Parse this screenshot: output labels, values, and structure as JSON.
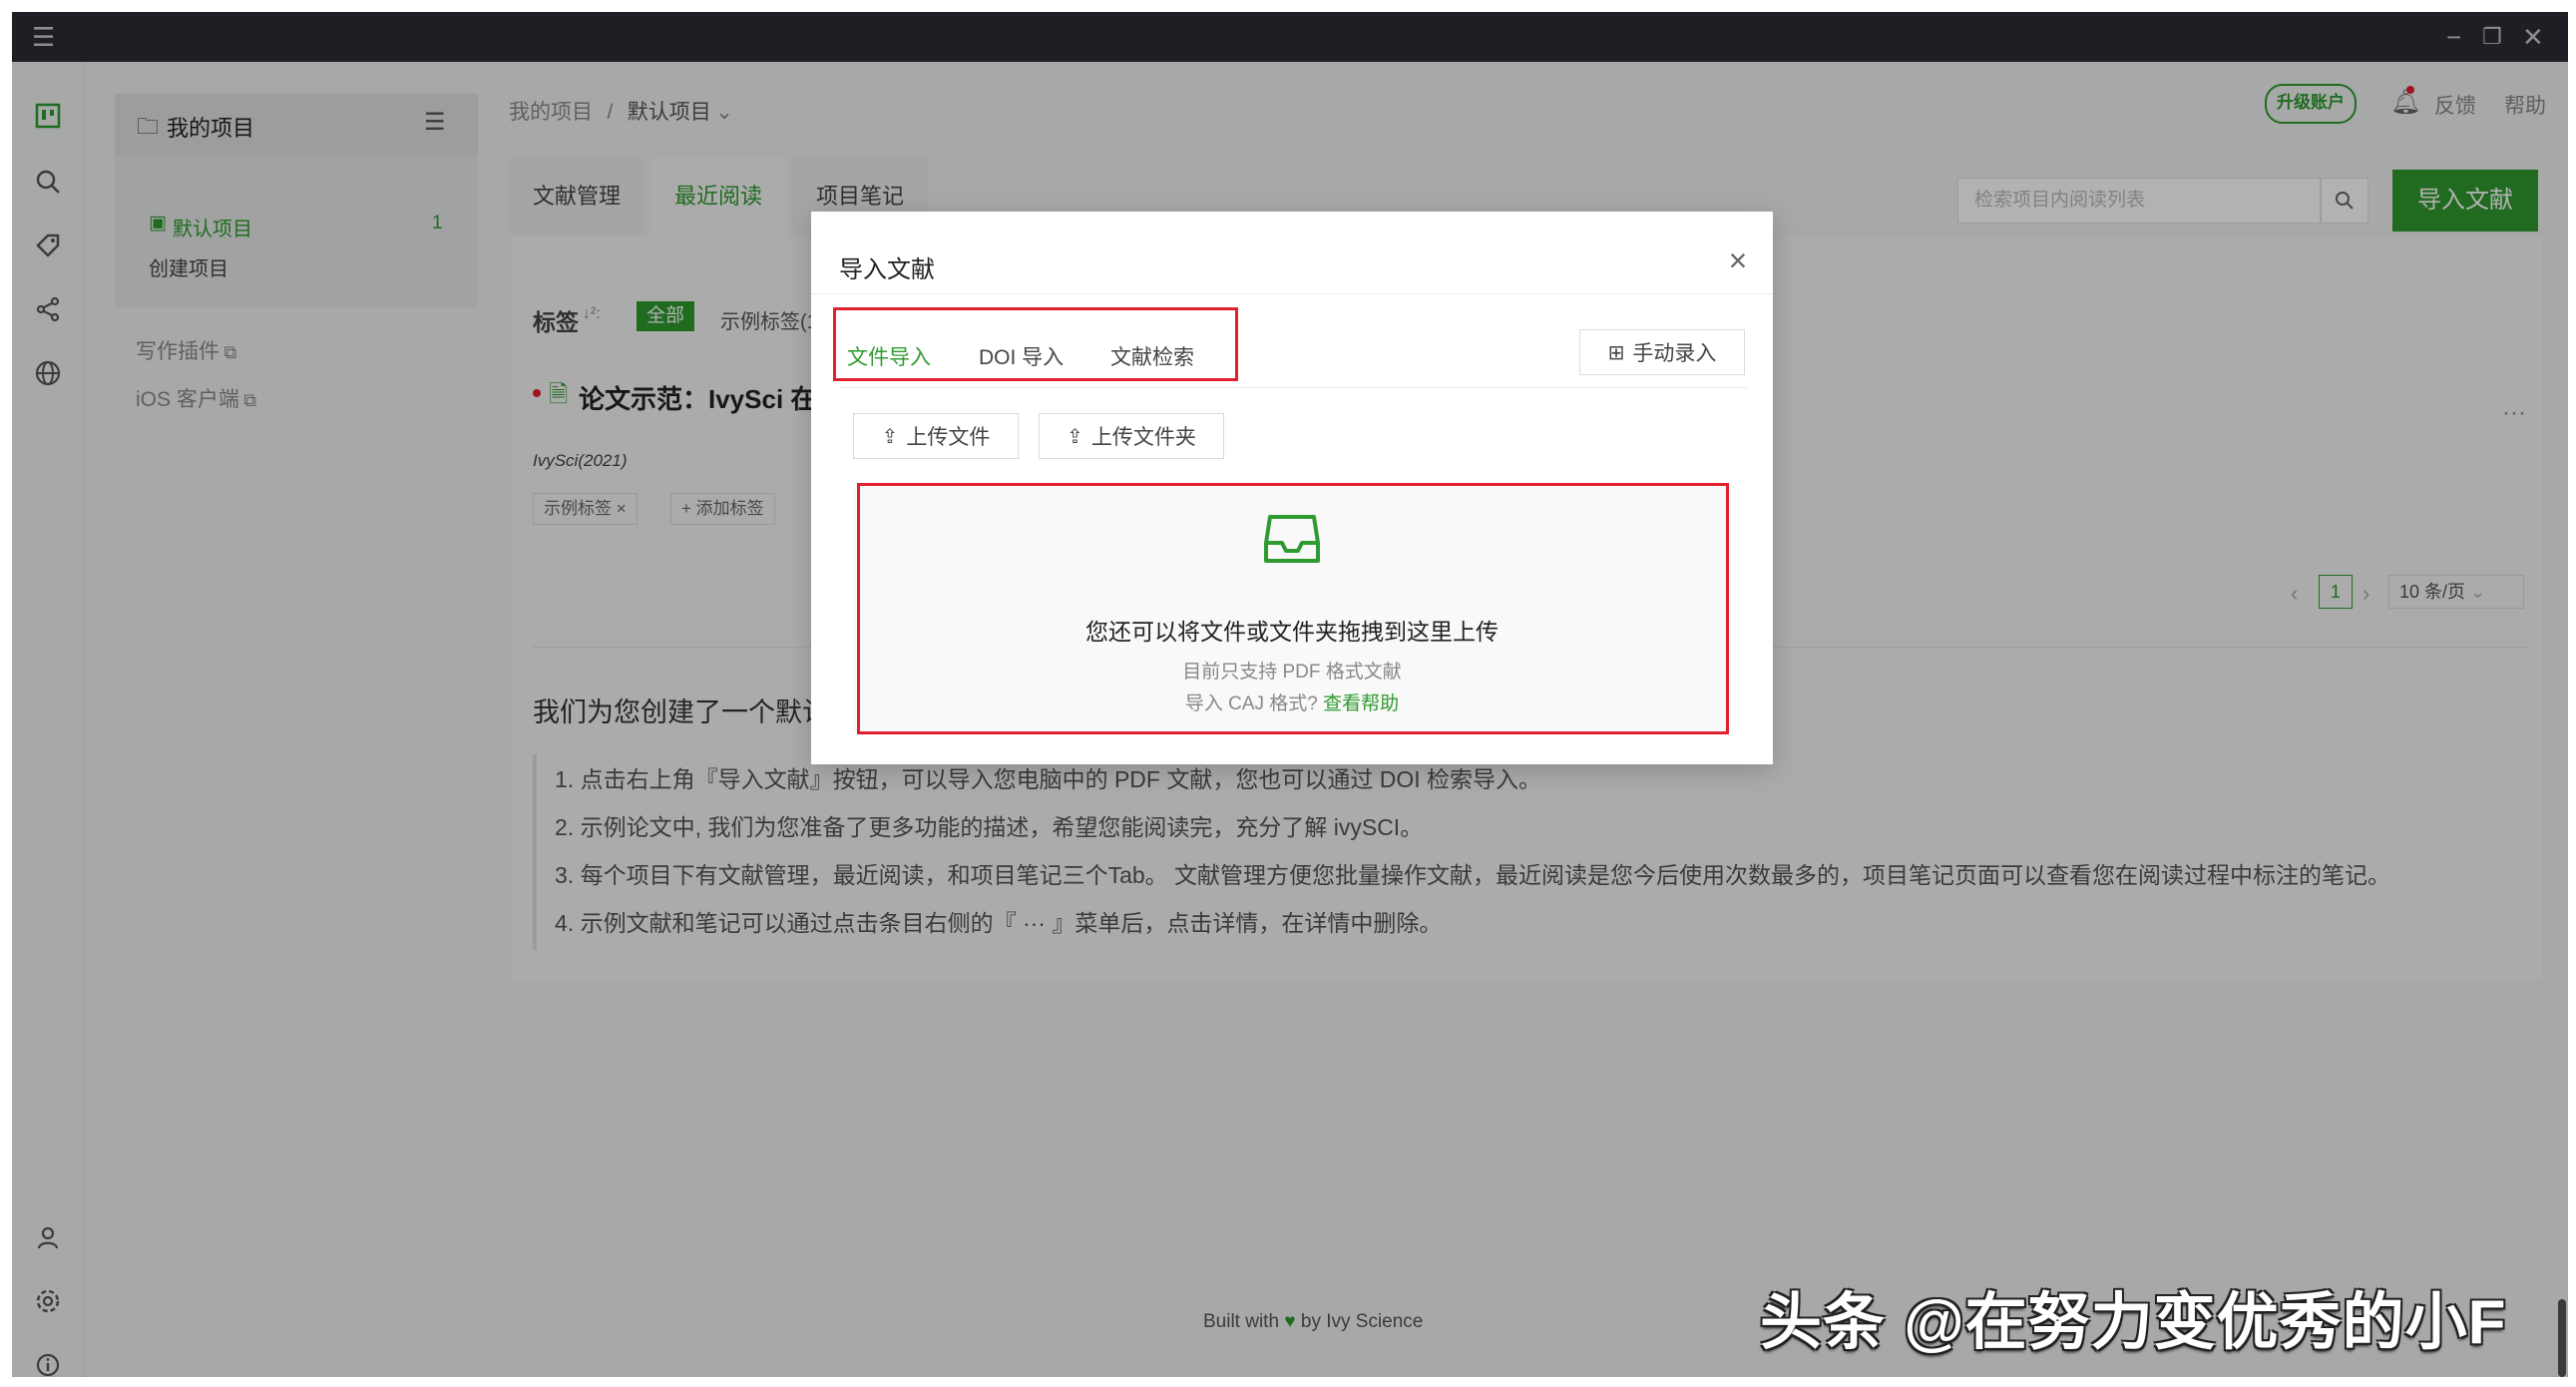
{
  "sidebar": {
    "section_title": "我的项目",
    "projects": [
      {
        "label": "默认项目",
        "count": "1"
      }
    ],
    "create_label": "创建项目",
    "links": [
      {
        "label": "写作插件"
      },
      {
        "label": "iOS 客户端"
      }
    ]
  },
  "header": {
    "breadcrumb_root": "我的项目",
    "breadcrumb_sep": "/",
    "breadcrumb_current": "默认项目",
    "upgrade_label": "升级账户",
    "feedback_label": "反馈",
    "help_label": "帮助"
  },
  "tabs": [
    {
      "label": "文献管理"
    },
    {
      "label": "最近阅读"
    },
    {
      "label": "项目笔记"
    }
  ],
  "search": {
    "placeholder": "检索项目内阅读列表"
  },
  "import_button": "导入文献",
  "tag_bar": {
    "label": "标签",
    "sort_glyph": "↓²:",
    "all": "全部",
    "sample": "示例标签(1"
  },
  "paper": {
    "title": "论文示范：IvySci 在",
    "source": "IvySci(2021)",
    "tag": "示例标签",
    "add_tag": "添加标签"
  },
  "pagination": {
    "current": "1",
    "page_size": "10 条/页"
  },
  "intro": {
    "heading": "我们为您创建了一个默认",
    "lines": [
      "1. 点击右上角『导入文献』按钮，可以导入您电脑中的 PDF 文献，您也可以通过 DOI 检索导入。",
      "2. 示例论文中, 我们为您准备了更多功能的描述，希望您能阅读完，充分了解 ivySCI。",
      "3. 每个项目下有文献管理，最近阅读，和项目笔记三个Tab。 文献管理方便您批量操作文献，最近阅读是您今后使用次数最多的，项目笔记页面可以查看您在阅读过程中标注的笔记。",
      "4. 示例文献和笔记可以通过点击条目右侧的『 ··· 』菜单后，点击详情，在详情中删除。"
    ]
  },
  "footer": {
    "prefix": "Built with",
    "suffix": "by Ivy Science"
  },
  "watermark": "头条 @在努力变优秀的小F",
  "modal": {
    "title": "导入文献",
    "tabs": [
      {
        "label": "文件导入"
      },
      {
        "label": "DOI 导入"
      },
      {
        "label": "文献检索"
      }
    ],
    "manual_entry": "手动录入",
    "upload_file": "上传文件",
    "upload_folder": "上传文件夹",
    "drop_main": "您还可以将文件或文件夹拖拽到这里上传",
    "drop_sub": "目前只支持 PDF 格式文献",
    "caj_prefix": "导入 CAJ 格式?",
    "caj_link": "查看帮助"
  },
  "colors": {
    "accent": "#2f9a2f",
    "highlight": "#e0212d",
    "titlebar": "#2c2d35"
  }
}
